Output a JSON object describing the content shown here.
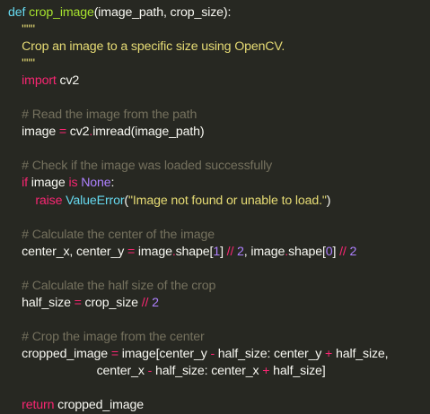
{
  "editor": {
    "theme_colors": {
      "background": "#272822",
      "text": "#f8f8f2",
      "keyword": "#f92672",
      "function": "#a6e22e",
      "string": "#e6db74",
      "comment": "#75715e",
      "number": "#ae81ff",
      "builtin": "#66d9ef"
    },
    "lines": [
      [
        {
          "t": "def ",
          "c": "cls"
        },
        {
          "t": "crop_image",
          "c": "fn"
        },
        {
          "t": "(image_path, crop_size):",
          "c": "plain"
        }
      ],
      [
        {
          "t": "    \"\"\"",
          "c": "str"
        }
      ],
      [
        {
          "t": "    Crop an image to a specific size using OpenCV.",
          "c": "str"
        }
      ],
      [
        {
          "t": "    \"\"\"",
          "c": "str"
        }
      ],
      [
        {
          "t": "    ",
          "c": "plain"
        },
        {
          "t": "import",
          "c": "kw"
        },
        {
          "t": " cv2",
          "c": "plain"
        }
      ],
      [
        {
          "t": "",
          "c": "plain"
        }
      ],
      [
        {
          "t": "    # Read the image from the path",
          "c": "cm"
        }
      ],
      [
        {
          "t": "    image ",
          "c": "plain"
        },
        {
          "t": "=",
          "c": "kw"
        },
        {
          "t": " cv2",
          "c": "plain"
        },
        {
          "t": ".",
          "c": "kw"
        },
        {
          "t": "imread(image_path)",
          "c": "plain"
        }
      ],
      [
        {
          "t": "",
          "c": "plain"
        }
      ],
      [
        {
          "t": "    # Check if the image was loaded successfully",
          "c": "cm"
        }
      ],
      [
        {
          "t": "    ",
          "c": "plain"
        },
        {
          "t": "if",
          "c": "kw"
        },
        {
          "t": " image ",
          "c": "plain"
        },
        {
          "t": "is",
          "c": "kw"
        },
        {
          "t": " ",
          "c": "plain"
        },
        {
          "t": "None",
          "c": "const"
        },
        {
          "t": ":",
          "c": "plain"
        }
      ],
      [
        {
          "t": "        ",
          "c": "plain"
        },
        {
          "t": "raise",
          "c": "kw"
        },
        {
          "t": " ",
          "c": "plain"
        },
        {
          "t": "ValueError",
          "c": "cls"
        },
        {
          "t": "(",
          "c": "plain"
        },
        {
          "t": "\"Image not found or unable to load.\"",
          "c": "str"
        },
        {
          "t": ")",
          "c": "plain"
        }
      ],
      [
        {
          "t": "",
          "c": "plain"
        }
      ],
      [
        {
          "t": "    # Calculate the center of the image",
          "c": "cm"
        }
      ],
      [
        {
          "t": "    center_x, center_y ",
          "c": "plain"
        },
        {
          "t": "=",
          "c": "kw"
        },
        {
          "t": " image",
          "c": "plain"
        },
        {
          "t": ".",
          "c": "kw"
        },
        {
          "t": "shape[",
          "c": "plain"
        },
        {
          "t": "1",
          "c": "num"
        },
        {
          "t": "] ",
          "c": "plain"
        },
        {
          "t": "//",
          "c": "kw"
        },
        {
          "t": " ",
          "c": "plain"
        },
        {
          "t": "2",
          "c": "num"
        },
        {
          "t": ", image",
          "c": "plain"
        },
        {
          "t": ".",
          "c": "kw"
        },
        {
          "t": "shape[",
          "c": "plain"
        },
        {
          "t": "0",
          "c": "num"
        },
        {
          "t": "] ",
          "c": "plain"
        },
        {
          "t": "//",
          "c": "kw"
        },
        {
          "t": " ",
          "c": "plain"
        },
        {
          "t": "2",
          "c": "num"
        }
      ],
      [
        {
          "t": "",
          "c": "plain"
        }
      ],
      [
        {
          "t": "    # Calculate the half size of the crop",
          "c": "cm"
        }
      ],
      [
        {
          "t": "    half_size ",
          "c": "plain"
        },
        {
          "t": "=",
          "c": "kw"
        },
        {
          "t": " crop_size ",
          "c": "plain"
        },
        {
          "t": "//",
          "c": "kw"
        },
        {
          "t": " ",
          "c": "plain"
        },
        {
          "t": "2",
          "c": "num"
        }
      ],
      [
        {
          "t": "",
          "c": "plain"
        }
      ],
      [
        {
          "t": "    # Crop the image from the center",
          "c": "cm"
        }
      ],
      [
        {
          "t": "    cropped_image ",
          "c": "plain"
        },
        {
          "t": "=",
          "c": "kw"
        },
        {
          "t": " image[center_y ",
          "c": "plain"
        },
        {
          "t": "-",
          "c": "kw"
        },
        {
          "t": " half_size: center_y ",
          "c": "plain"
        },
        {
          "t": "+",
          "c": "kw"
        },
        {
          "t": " half_size,",
          "c": "plain"
        }
      ],
      [
        {
          "t": "                          center_x ",
          "c": "plain"
        },
        {
          "t": "-",
          "c": "kw"
        },
        {
          "t": " half_size: center_x ",
          "c": "plain"
        },
        {
          "t": "+",
          "c": "kw"
        },
        {
          "t": " half_size]",
          "c": "plain"
        }
      ],
      [
        {
          "t": "",
          "c": "plain"
        }
      ],
      [
        {
          "t": "    ",
          "c": "plain"
        },
        {
          "t": "return",
          "c": "kw"
        },
        {
          "t": " cropped_image",
          "c": "plain"
        }
      ]
    ]
  }
}
